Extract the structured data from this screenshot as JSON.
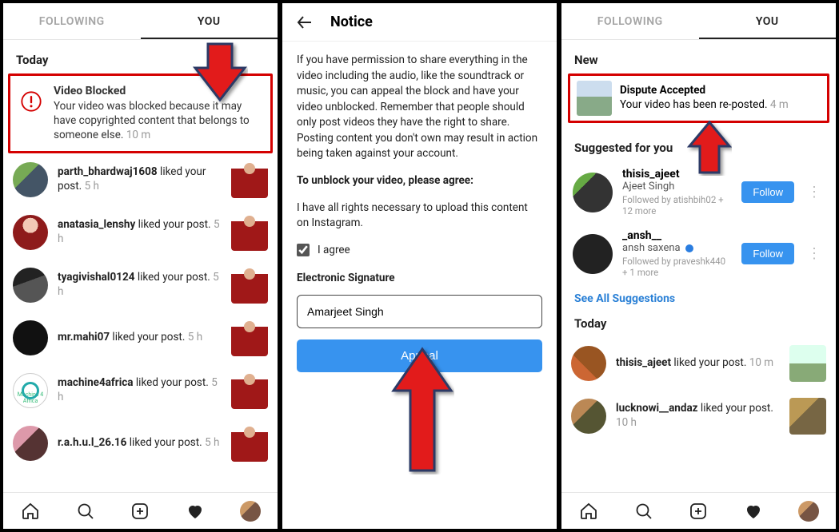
{
  "tabs": {
    "following": "FOLLOWING",
    "you": "YOU"
  },
  "panel1": {
    "section": "Today",
    "blocked": {
      "title": "Video Blocked",
      "body": "Your video was blocked because it may have copyrighted content that belongs to someone else.",
      "time": "10 m"
    },
    "feed": [
      {
        "user": "parth_bhardwaj1608",
        "action": "liked your post.",
        "time": "5 h"
      },
      {
        "user": "anatasia_lenshy",
        "action": "liked your post.",
        "time": "5 h"
      },
      {
        "user": "tyagivishal0124",
        "action": "liked your post.",
        "time": "5 h"
      },
      {
        "user": "mr.mahi07",
        "action": "liked your post.",
        "time": "5 h"
      },
      {
        "user": "machine4africa",
        "action": "liked your post.",
        "time": "5 h",
        "avatar_label": "Machine 4 Africa"
      },
      {
        "user": "r.a.h.u.l_26.16",
        "action": "liked your post.",
        "time": "5 h"
      }
    ]
  },
  "panel2": {
    "title": "Notice",
    "paragraph": "If you have permission to share everything in the video including the audio, like the soundtrack or music, you can appeal the block and have your video unblocked. Remember that people should only post videos they have the right to share. Posting content you don't own may result in action being taken against your account.",
    "unblock_label": "To unblock your video, please agree:",
    "rights_text": "I have all rights necessary to upload this content on Instagram.",
    "agree_label": "I agree",
    "sig_label": "Electronic Signature",
    "sig_value": "Amarjeet Singh",
    "appeal_label": "Appeal"
  },
  "panel3": {
    "new_label": "New",
    "accepted": {
      "title": "Dispute Accepted",
      "body": "Your video has been re-posted.",
      "time": "4 m"
    },
    "suggested_label": "Suggested for you",
    "suggestions": [
      {
        "user": "thisis_ajeet",
        "name": "Ajeet Singh",
        "followedby": "Followed by atishbih02 + 12 more"
      },
      {
        "user": "_ansh__",
        "name": "ansh saxena",
        "followedby": "Followed by praveshk440 + 1 more"
      }
    ],
    "follow_label": "Follow",
    "see_all": "See All Suggestions",
    "today_label": "Today",
    "today_feed": [
      {
        "user": "thisis_ajeet",
        "action": "liked your post.",
        "time": "10 m"
      },
      {
        "user": "lucknowi__andaz",
        "action": "liked your post.",
        "time": "10 h"
      }
    ]
  }
}
